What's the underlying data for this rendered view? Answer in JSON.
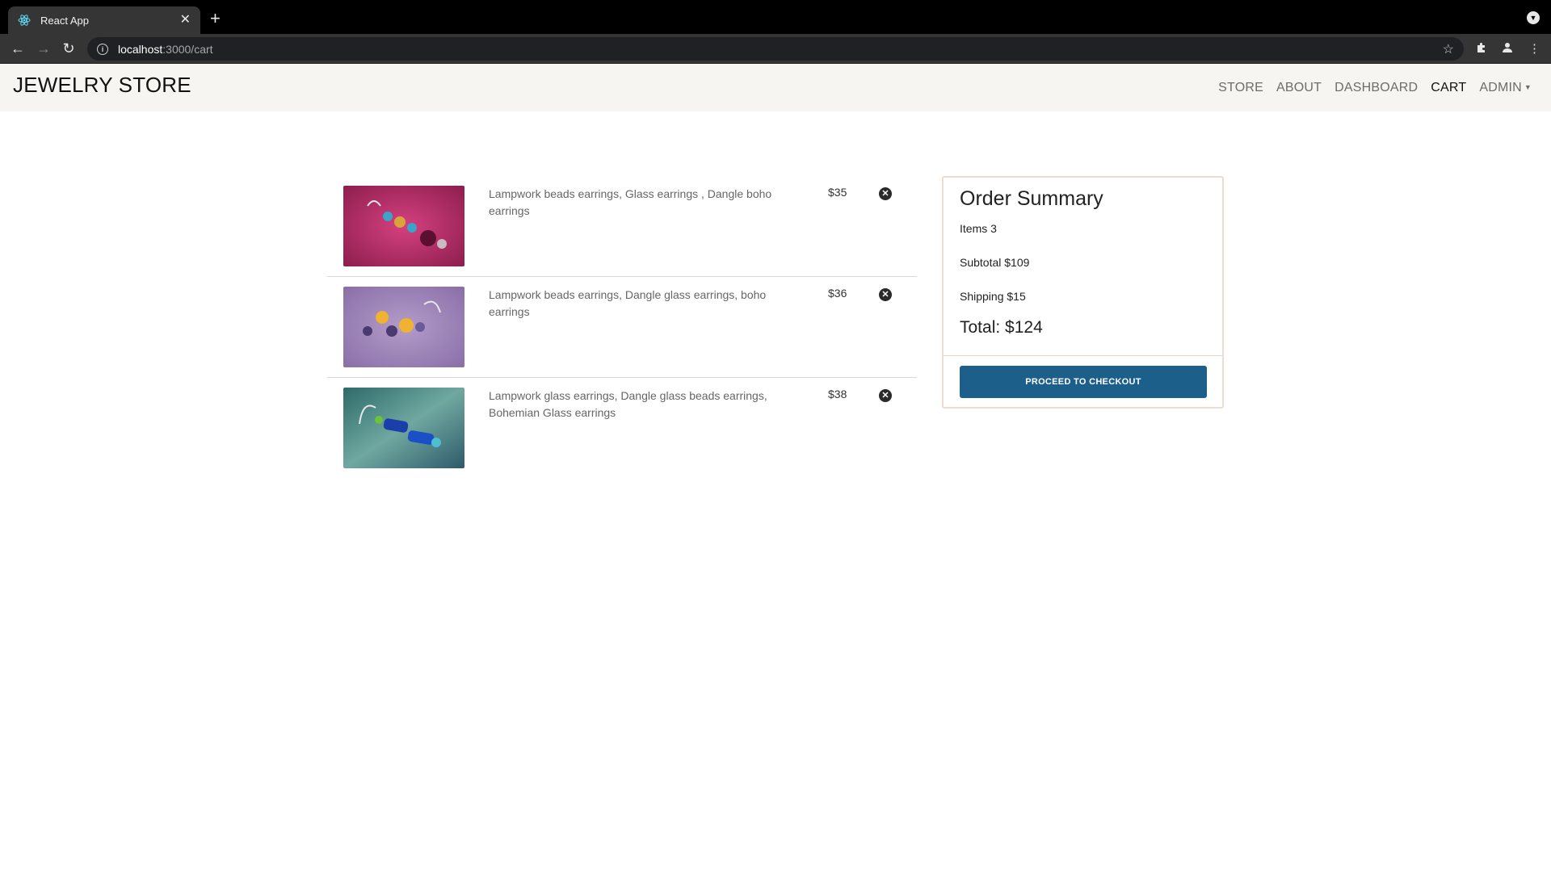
{
  "browser": {
    "tab_title": "React App",
    "url_host": "localhost",
    "url_path": ":3000/cart"
  },
  "navbar": {
    "brand": "JEWELRY STORE",
    "links": [
      {
        "label": "STORE"
      },
      {
        "label": "ABOUT"
      },
      {
        "label": "DASHBOARD"
      },
      {
        "label": "CART",
        "active": true
      },
      {
        "label": "ADMIN"
      }
    ]
  },
  "cart": {
    "items": [
      {
        "name": "Lampwork beads earrings, Glass earrings , Dangle boho earrings",
        "price": "$35",
        "image": "pink-earrings-photo"
      },
      {
        "name": "Lampwork beads earrings, Dangle glass earrings, boho earrings",
        "price": "$36",
        "image": "lavender-earrings-photo"
      },
      {
        "name": "Lampwork glass earrings, Dangle glass beads earrings, Bohemian Glass earrings",
        "price": "$38",
        "image": "blue-earrings-photo"
      }
    ]
  },
  "summary": {
    "title": "Order Summary",
    "items": "Items 3",
    "subtotal": "Subtotal $109",
    "shipping": "Shipping $15",
    "total": "Total: $124",
    "checkout_label": "PROCEED TO CHECKOUT"
  },
  "colors": {
    "navbar_bg": "#f7f5f1",
    "checkout_button": "#1c5f8a",
    "summary_border": "#ecdcd1"
  }
}
